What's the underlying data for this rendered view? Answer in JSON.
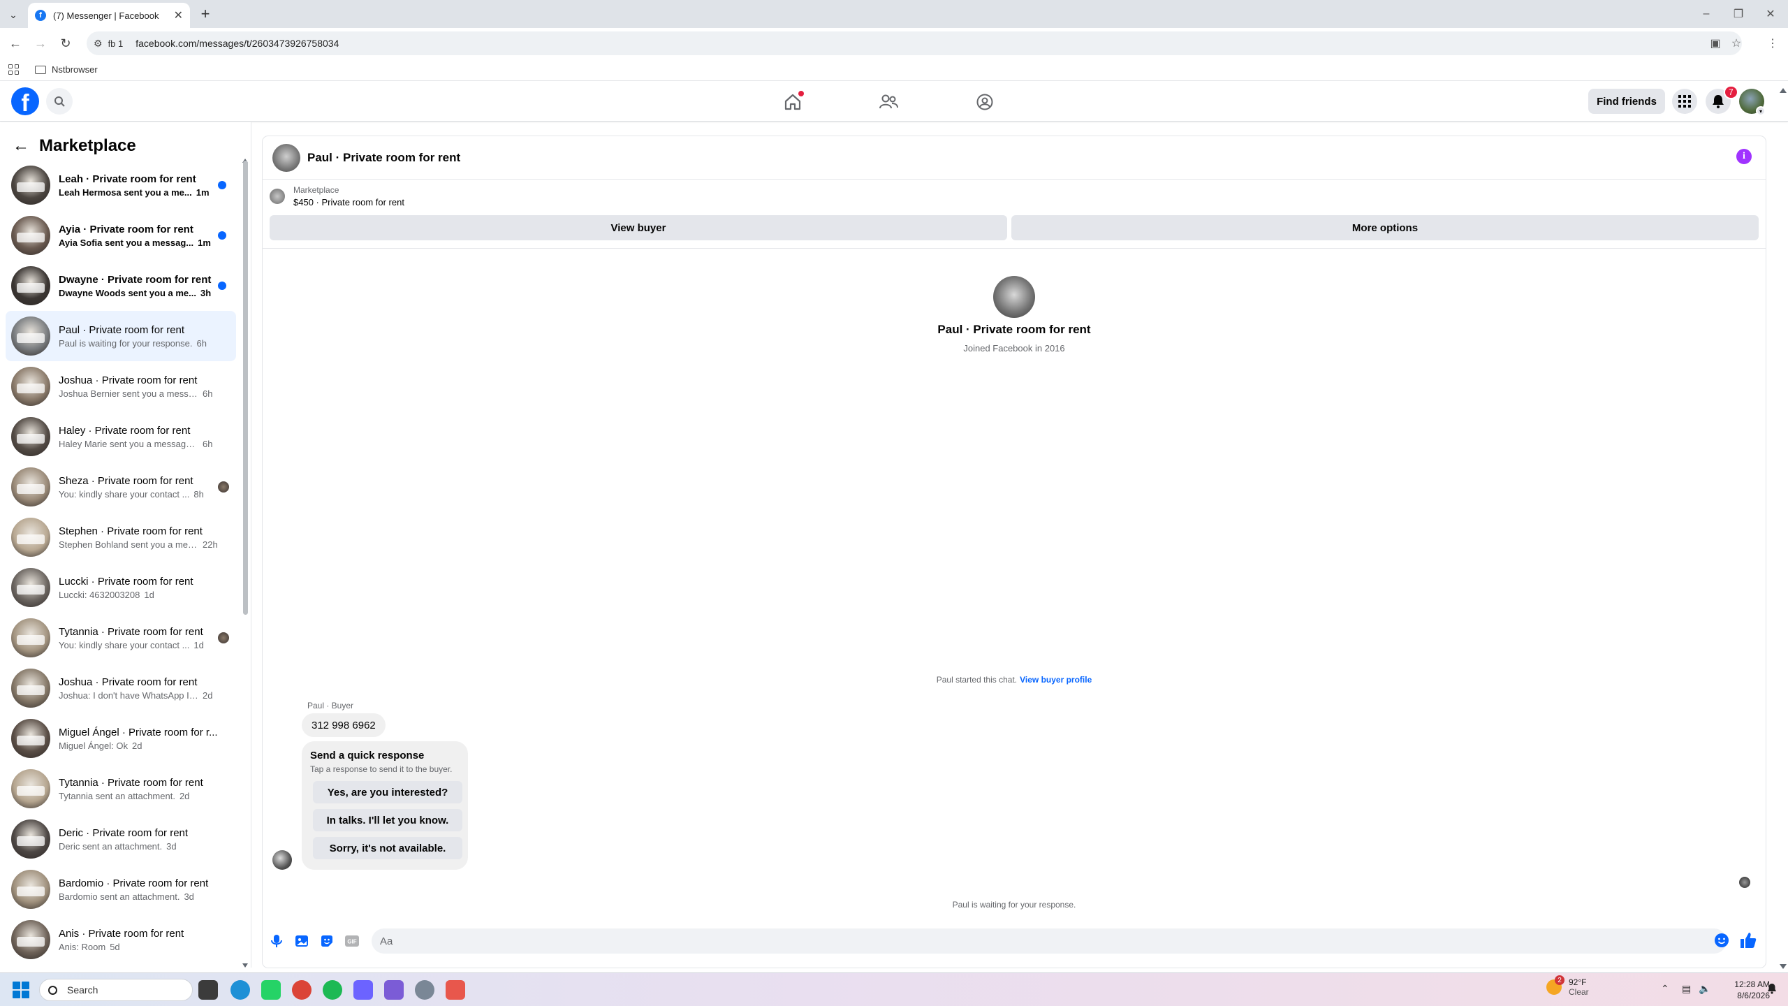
{
  "browser": {
    "tab_title": "(7) Messenger | Facebook",
    "tab_favicon": "f",
    "profile_label": "fb 1",
    "url": "facebook.com/messages/t/2603473926758034",
    "bookmark_folder": "Nstbrowser"
  },
  "fb_header": {
    "logo": "f",
    "find_friends": "Find friends",
    "notification_count": "7",
    "accent": "#0866ff"
  },
  "sidebar": {
    "title": "Marketplace",
    "conversations": [
      {
        "title": "Leah · Private room for rent",
        "msg": "Leah Hermosa sent you a me...",
        "time": "1m",
        "unread": true,
        "color": "#4b4540"
      },
      {
        "title": "Ayia · Private room for rent",
        "msg": "Ayia Sofia sent you a messag...",
        "time": "1m",
        "unread": true,
        "color": "#6a5a50"
      },
      {
        "title": "Dwayne · Private room for rent",
        "msg": "Dwayne Woods sent you a me...",
        "time": "3h",
        "unread": true,
        "color": "#3b3633"
      },
      {
        "title": "Paul · Private room for rent",
        "msg": "Paul is waiting for your response.",
        "time": "6h",
        "unread": false,
        "active": true,
        "color": "#7a7d80"
      },
      {
        "title": "Joshua · Private room for rent",
        "msg": "Joshua Bernier sent you a messa...",
        "time": "6h",
        "unread": false,
        "color": "#8b7b6b"
      },
      {
        "title": "Haley · Private room for rent",
        "msg": "Haley Marie sent you a message ...",
        "time": "6h",
        "unread": false,
        "color": "#534b45"
      },
      {
        "title": "Sheza · Private room for rent",
        "msg": "You: kindly share your contact ...",
        "time": "8h",
        "unread": false,
        "seen": true,
        "color": "#9a8a78"
      },
      {
        "title": "Stephen · Private room for rent",
        "msg": "Stephen Bohland sent you a mes...",
        "time": "22h",
        "unread": false,
        "color": "#b8a892"
      },
      {
        "title": "Luccki · Private room for rent",
        "msg": "Luccki: 4632003208",
        "time": "1d",
        "unread": false,
        "color": "#6b6560"
      },
      {
        "title": "Tytannia · Private room for rent",
        "msg": "You: kindly share your contact ...",
        "time": "1d",
        "unread": false,
        "seen": true,
        "color": "#a39480"
      },
      {
        "title": "Joshua · Private room for rent",
        "msg": "Joshua: I don't have WhatsApp I d...",
        "time": "2d",
        "unread": false,
        "color": "#857868"
      },
      {
        "title": "Miguel Ángel · Private room for r...",
        "msg": "Miguel Ángel: Ok",
        "time": "2d",
        "unread": false,
        "color": "#5a4e46"
      },
      {
        "title": "Tytannia · Private room for rent",
        "msg": "Tytannia sent an attachment.",
        "time": "2d",
        "unread": false,
        "color": "#b5a58f"
      },
      {
        "title": "Deric · Private room for rent",
        "msg": "Deric sent an attachment.",
        "time": "3d",
        "unread": false,
        "color": "#4d4744"
      },
      {
        "title": "Bardomio · Private room for rent",
        "msg": "Bardomio sent an attachment.",
        "time": "3d",
        "unread": false,
        "color": "#9f907c"
      },
      {
        "title": "Anis · Private room for rent",
        "msg": "Anis: Room",
        "time": "5d",
        "unread": false,
        "color": "#6e6258"
      }
    ]
  },
  "chat": {
    "header_name": "Paul · Private room for rent",
    "listing_label": "Marketplace",
    "listing_value": "$450 · Private room for rent",
    "view_buyer": "View buyer",
    "more_options": "More options",
    "profile_name": "Paul · Private room for rent",
    "profile_joined": "Joined Facebook in 2016",
    "started_text": "Paul started this chat.",
    "started_link": "View buyer profile",
    "sender_label": "Paul · Buyer",
    "phone_message": "312 998 6962",
    "quick_response_title": "Send a quick response",
    "quick_response_sub": "Tap a response to send it to the buyer.",
    "quick_responses": [
      "Yes, are you interested?",
      "In talks. I'll let you know.",
      "Sorry, it's not available."
    ],
    "waiting_text": "Paul is waiting for your response.",
    "input_placeholder": "Aa"
  },
  "taskbar": {
    "search_placeholder": "Search",
    "weather_temp": "92°F",
    "weather_cond": "Clear",
    "weather_badge": "2",
    "time": "12:28 AM",
    "date": "8/6/2026"
  }
}
